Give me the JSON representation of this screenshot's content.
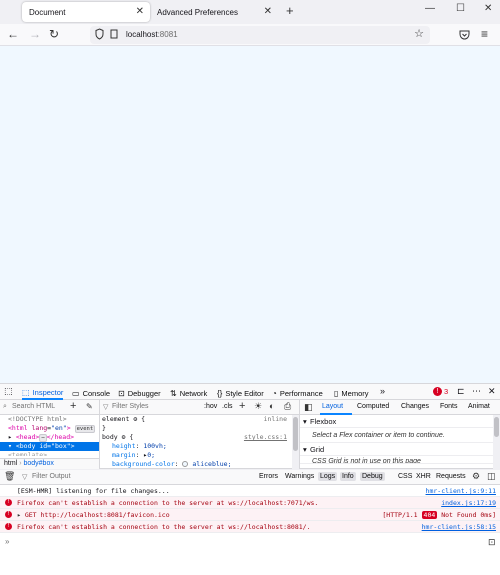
{
  "tabs": [
    {
      "title": "Document",
      "active": true
    },
    {
      "title": "Advanced Preferences",
      "active": false
    }
  ],
  "url": {
    "host": "localhost",
    "port": ":8081"
  },
  "page": {
    "background_color": "aliceblue"
  },
  "devtools": {
    "tools": [
      {
        "label": "Inspector",
        "icon": "inspector-icon",
        "active": true
      },
      {
        "label": "Console",
        "icon": "console-icon"
      },
      {
        "label": "Debugger",
        "icon": "debugger-icon"
      },
      {
        "label": "Network",
        "icon": "network-icon"
      },
      {
        "label": "Style Editor",
        "icon": "style-editor-icon"
      },
      {
        "label": "Performance",
        "icon": "performance-icon"
      },
      {
        "label": "Memory",
        "icon": "memory-icon"
      }
    ],
    "error_count": "3",
    "markup": {
      "search_placeholder": "Search HTML",
      "doctype": "<!DOCTYPE html>",
      "html_open": "<html",
      "html_attr": "lang",
      "html_attr_val": "\"en\"",
      "event_badge": "event",
      "head_line": "<head>",
      "head_collapsed": "</head>",
      "body_open": "<body",
      "body_attr": "id",
      "body_attr_val": "\"box\"",
      "truncated": "<template>",
      "breadcrumb_html": "html",
      "breadcrumb_body": "body#box"
    },
    "rules": {
      "filter_placeholder": "Filter Styles",
      "hov": ":hov",
      "cls": ".cls",
      "element_selector": "element",
      "element_source": "inline",
      "body_selector": "body",
      "body_source": "style.css:1",
      "declarations": [
        {
          "prop": "height",
          "value": "100vh;"
        },
        {
          "prop": "margin",
          "value": "0;"
        },
        {
          "prop": "background-color",
          "value": "aliceblue;"
        }
      ]
    },
    "layout_tabs": [
      "Layout",
      "Computed",
      "Changes",
      "Fonts",
      "Animat"
    ],
    "layout": {
      "flexbox_title": "Flexbox",
      "flexbox_hint": "Select a Flex container or item to continue.",
      "grid_title": "Grid",
      "grid_hint": "CSS Grid is not in use on this page"
    },
    "console": {
      "filter_placeholder": "Filter Output",
      "filters": [
        "Errors",
        "Warnings",
        "Logs",
        "Info",
        "Debug",
        "CSS",
        "XHR",
        "Requests"
      ],
      "active_filters": [
        "Logs",
        "Info",
        "Debug"
      ],
      "messages": [
        {
          "type": "log",
          "text": "[ESM-HMR] listening for file changes...",
          "location": "hmr-client.js:9:11"
        },
        {
          "type": "error",
          "text": "Firefox can't establish a connection to the server at ws://localhost:7071/ws.",
          "location": "index.js:17:19"
        },
        {
          "type": "error",
          "text": "GET http://localhost:8081/favicon.ico",
          "status": "[HTTP/1.1",
          "status_code": "404",
          "status_text": "Not Found 0ms]",
          "location": ""
        },
        {
          "type": "error",
          "text": "Firefox can't establish a connection to the server at ws://localhost:8081/.",
          "location": "hmr-client.js:58:15"
        }
      ]
    }
  }
}
